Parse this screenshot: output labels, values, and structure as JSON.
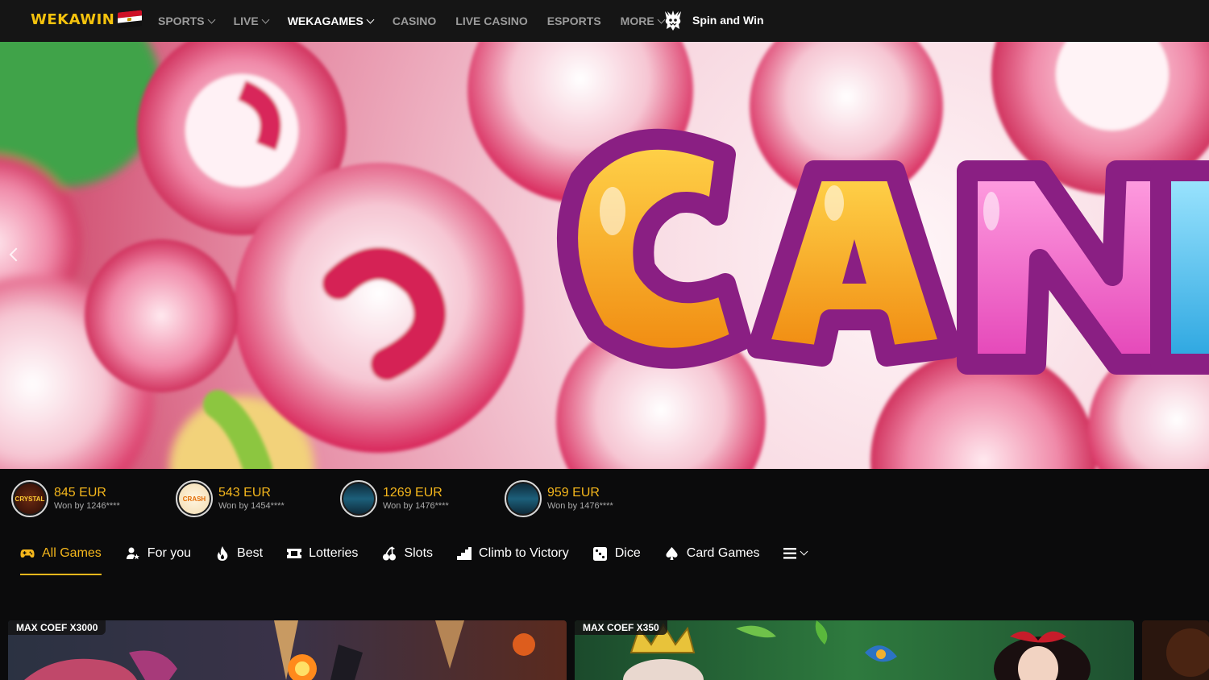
{
  "brand": {
    "logo_part1": "WEKA",
    "logo_part2": "WIN"
  },
  "nav": {
    "items": [
      {
        "label": "SPORTS",
        "dropdown": true
      },
      {
        "label": "LIVE",
        "dropdown": true
      },
      {
        "label": "WEKAGAMES",
        "dropdown": true
      },
      {
        "label": "CASINO",
        "dropdown": false
      },
      {
        "label": "LIVE CASINO",
        "dropdown": false
      },
      {
        "label": "ESPORTS",
        "dropdown": false
      },
      {
        "label": "MORE",
        "dropdown": true
      }
    ],
    "spin_label": "Spin and Win"
  },
  "hero": {
    "banner_text": "CANI"
  },
  "winners": [
    {
      "amount": "845 EUR",
      "by": "Won by 1246****",
      "game_logo": "CRYSTAL"
    },
    {
      "amount": "543 EUR",
      "by": "Won by 1454****",
      "game_logo": "CRASH"
    },
    {
      "amount": "1269 EUR",
      "by": "Won by 1476****",
      "game_logo": ""
    },
    {
      "amount": "959 EUR",
      "by": "Won by 1476****",
      "game_logo": ""
    }
  ],
  "tabs": [
    {
      "label": "All Games",
      "icon": "gamepad-icon"
    },
    {
      "label": "For you",
      "icon": "user-star-icon"
    },
    {
      "label": "Best",
      "icon": "fire-icon"
    },
    {
      "label": "Lotteries",
      "icon": "ticket-icon"
    },
    {
      "label": "Slots",
      "icon": "cherry-icon"
    },
    {
      "label": "Climb to Victory",
      "icon": "stairs-icon"
    },
    {
      "label": "Dice",
      "icon": "dice-icon"
    },
    {
      "label": "Card Games",
      "icon": "spade-icon"
    }
  ],
  "cards": [
    {
      "badge": "MAX COEF X3000"
    },
    {
      "badge": "MAX COEF X350"
    }
  ],
  "colors": {
    "accent": "#f5b71c",
    "topbar": "#151515",
    "page_bg": "#0b0b0c"
  }
}
